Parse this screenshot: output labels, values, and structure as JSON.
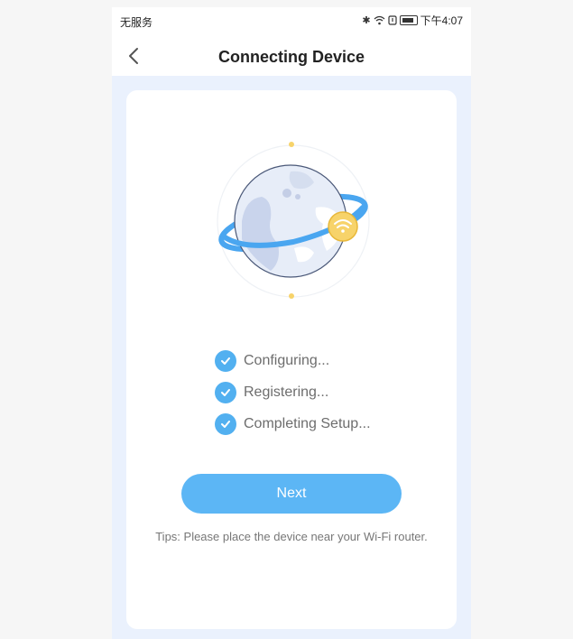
{
  "status_bar": {
    "carrier": "无服务",
    "time": "下午4:07",
    "icons": [
      "bluetooth-icon",
      "wifi-icon",
      "alarm-icon",
      "battery-icon"
    ]
  },
  "header": {
    "title": "Connecting Device",
    "back_icon": "chevron-left-icon"
  },
  "steps": [
    {
      "label": "Configuring...",
      "done": true
    },
    {
      "label": "Registering...",
      "done": true
    },
    {
      "label": "Completing Setup...",
      "done": true
    }
  ],
  "next_button": {
    "label": "Next"
  },
  "tips": "Tips: Please place the device near your Wi-Fi router.",
  "colors": {
    "accent": "#5cb6f5",
    "check": "#52b0f0",
    "background": "#eaf1fd",
    "wifi_badge": "#f7d36a",
    "orbit": "#4aa6f0"
  }
}
